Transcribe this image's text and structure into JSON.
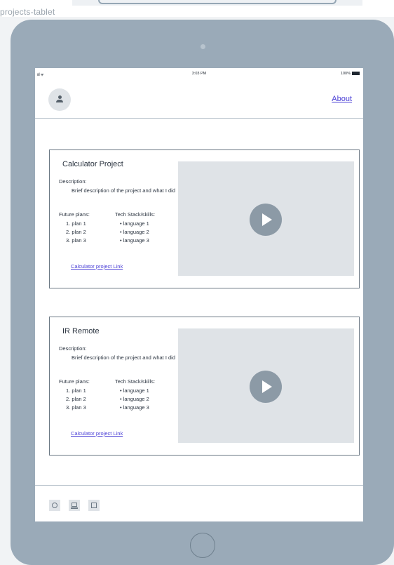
{
  "frame": {
    "label": "projects-tablet"
  },
  "status_bar": {
    "signal": "ııl ᯤ",
    "time": "3:03 PM",
    "battery": "100%"
  },
  "header": {
    "about_label": "About"
  },
  "projects": [
    {
      "title": "Calculator Project",
      "description_label": "Description:",
      "description": "Brief description of the project and what I did",
      "plans_heading": "Future plans:",
      "plans": [
        "1.  plan 1",
        "2.  plan 2",
        "3.  plan 3"
      ],
      "stack_heading": "Tech Stack/skills:",
      "stack": [
        "•  language 1",
        "•  language 2",
        "•  language 3"
      ],
      "link_label": "Calculator project Link"
    },
    {
      "title": "IR Remote",
      "description_label": "Description:",
      "description": "Brief description of the project and what I did",
      "plans_heading": "Future plans:",
      "plans": [
        "1.  plan 1",
        "2.  plan 2",
        "3.  plan 3"
      ],
      "stack_heading": "Tech Stack/skills:",
      "stack": [
        "•  language 1",
        "•  language 2",
        "•  language 3"
      ],
      "link_label": "Calculator project Link"
    }
  ],
  "footer": {
    "icons": [
      "github-icon",
      "laptop-icon",
      "linkedin-icon"
    ]
  },
  "colors": {
    "accent": "#4a3fd6",
    "device": "#9aaab8",
    "placeholder": "#dfe3e7"
  }
}
